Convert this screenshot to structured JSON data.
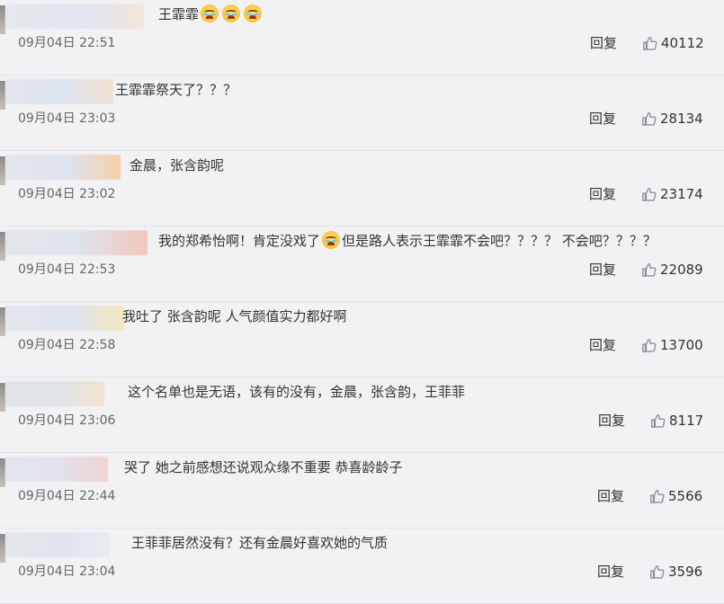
{
  "reply_label": "回复",
  "colors": {
    "background": "#f2f2f5",
    "text": "#333333",
    "time": "#666666",
    "icon": "#8a8fa0"
  },
  "comments": [
    {
      "text_before": "王霏霏",
      "emojis": 3,
      "text_after": "",
      "time": "09月04日 22:51",
      "likes": "40112"
    },
    {
      "text_before": "王霏霏祭天了？？？",
      "emojis": 0,
      "text_after": "",
      "time": "09月04日 23:03",
      "likes": "28134"
    },
    {
      "text_before": "金晨，张含韵呢",
      "emojis": 0,
      "text_after": "",
      "time": "09月04日 23:02",
      "likes": "23174"
    },
    {
      "text_before": "我的郑希怡啊！肯定没戏了",
      "emojis": 1,
      "text_after": "但是路人表示王霏霏不会吧？？？？ 不会吧？？？？",
      "time": "09月04日 22:53",
      "likes": "22089"
    },
    {
      "text_before": "我吐了 张含韵呢 人气颜值实力都好啊",
      "emojis": 0,
      "text_after": "",
      "time": "09月04日 22:58",
      "likes": "13700"
    },
    {
      "text_before": "这个名单也是无语，该有的没有，金晨，张含韵，王菲菲",
      "emojis": 0,
      "text_after": "",
      "time": "09月04日 23:06",
      "likes": "8117"
    },
    {
      "text_before": "哭了 她之前感想还说观众缘不重要 恭喜龄龄子",
      "emojis": 0,
      "text_after": "",
      "time": "09月04日 22:44",
      "likes": "5566"
    },
    {
      "text_before": "王菲菲居然没有？还有金晨好喜欢她的气质",
      "emojis": 0,
      "text_after": "",
      "time": "09月04日 23:04",
      "likes": "3596"
    }
  ]
}
